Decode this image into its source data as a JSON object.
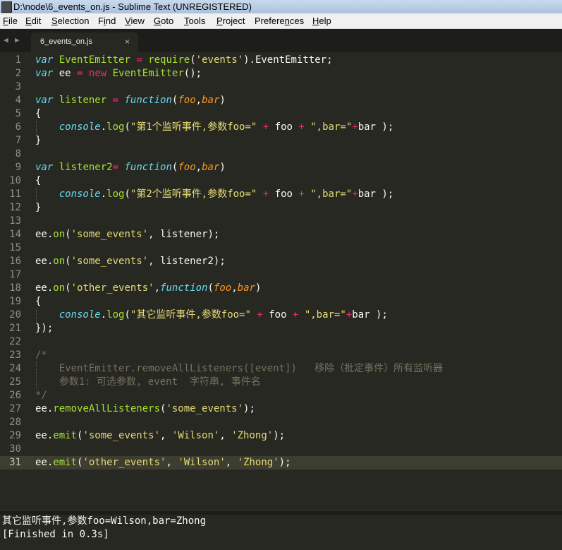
{
  "window": {
    "title": "D:\\node\\6_events_on.js - Sublime Text (UNREGISTERED)"
  },
  "menu": [
    {
      "name": "file",
      "pre": "",
      "u": "F",
      "post": "ile"
    },
    {
      "name": "edit",
      "pre": "",
      "u": "E",
      "post": "dit"
    },
    {
      "name": "selection",
      "pre": "",
      "u": "S",
      "post": "election"
    },
    {
      "name": "find",
      "pre": "F",
      "u": "i",
      "post": "nd"
    },
    {
      "name": "view",
      "pre": "",
      "u": "V",
      "post": "iew"
    },
    {
      "name": "goto",
      "pre": "",
      "u": "G",
      "post": "oto"
    },
    {
      "name": "tools",
      "pre": "",
      "u": "T",
      "post": "ools"
    },
    {
      "name": "project",
      "pre": "",
      "u": "P",
      "post": "roject"
    },
    {
      "name": "preferences",
      "pre": "Prefere",
      "u": "n",
      "post": "ces"
    },
    {
      "name": "help",
      "pre": "",
      "u": "H",
      "post": "elp"
    }
  ],
  "tab": {
    "label": "6_events_on.js",
    "close": "×",
    "nav_left": "◀",
    "nav_right": "▶"
  },
  "editor": {
    "current_line": 31,
    "lines": [
      {
        "n": "1",
        "t": [
          [
            "kw",
            "var"
          ],
          [
            "pl",
            " "
          ],
          [
            "fn",
            "EventEmitter"
          ],
          [
            "pl",
            " "
          ],
          [
            "op",
            "="
          ],
          [
            "pl",
            " "
          ],
          [
            "fn",
            "require"
          ],
          [
            "pl",
            "("
          ],
          [
            "str",
            "'events'"
          ],
          [
            "pl",
            ").EventEmitter;"
          ]
        ]
      },
      {
        "n": "2",
        "t": [
          [
            "kw",
            "var"
          ],
          [
            "pl",
            " ee "
          ],
          [
            "op",
            "="
          ],
          [
            "pl",
            " "
          ],
          [
            "op",
            "new"
          ],
          [
            "pl",
            " "
          ],
          [
            "fn",
            "EventEmitter"
          ],
          [
            "pl",
            "();"
          ]
        ]
      },
      {
        "n": "3",
        "t": []
      },
      {
        "n": "4",
        "t": [
          [
            "kw",
            "var"
          ],
          [
            "pl",
            " "
          ],
          [
            "fn",
            "listener"
          ],
          [
            "pl",
            " "
          ],
          [
            "op",
            "="
          ],
          [
            "pl",
            " "
          ],
          [
            "kw",
            "function"
          ],
          [
            "pl",
            "("
          ],
          [
            "param",
            "foo"
          ],
          [
            "pl",
            ","
          ],
          [
            "param",
            "bar"
          ],
          [
            "pl",
            ")"
          ]
        ]
      },
      {
        "n": "5",
        "t": [
          [
            "pl",
            "{"
          ]
        ]
      },
      {
        "n": "6",
        "g": true,
        "t": [
          [
            "pl",
            "    "
          ],
          [
            "kw",
            "console"
          ],
          [
            "pl",
            "."
          ],
          [
            "fn",
            "log"
          ],
          [
            "pl",
            "("
          ],
          [
            "str",
            "\"第1个监听事件,参数foo=\""
          ],
          [
            "pl",
            " "
          ],
          [
            "op",
            "+"
          ],
          [
            "pl",
            " foo "
          ],
          [
            "op",
            "+"
          ],
          [
            "pl",
            " "
          ],
          [
            "str",
            "\",bar=\""
          ],
          [
            "op",
            "+"
          ],
          [
            "pl",
            "bar );"
          ]
        ]
      },
      {
        "n": "7",
        "t": [
          [
            "pl",
            "}"
          ]
        ]
      },
      {
        "n": "8",
        "t": []
      },
      {
        "n": "9",
        "t": [
          [
            "kw",
            "var"
          ],
          [
            "pl",
            " "
          ],
          [
            "fn",
            "listener2"
          ],
          [
            "op",
            "="
          ],
          [
            "pl",
            " "
          ],
          [
            "kw",
            "function"
          ],
          [
            "pl",
            "("
          ],
          [
            "param",
            "foo"
          ],
          [
            "pl",
            ","
          ],
          [
            "param",
            "bar"
          ],
          [
            "pl",
            ")"
          ]
        ]
      },
      {
        "n": "10",
        "t": [
          [
            "pl",
            "{"
          ]
        ]
      },
      {
        "n": "11",
        "g": true,
        "t": [
          [
            "pl",
            "    "
          ],
          [
            "kw",
            "console"
          ],
          [
            "pl",
            "."
          ],
          [
            "fn",
            "log"
          ],
          [
            "pl",
            "("
          ],
          [
            "str",
            "\"第2个监听事件,参数foo=\""
          ],
          [
            "pl",
            " "
          ],
          [
            "op",
            "+"
          ],
          [
            "pl",
            " foo "
          ],
          [
            "op",
            "+"
          ],
          [
            "pl",
            " "
          ],
          [
            "str",
            "\",bar=\""
          ],
          [
            "op",
            "+"
          ],
          [
            "pl",
            "bar );"
          ]
        ]
      },
      {
        "n": "12",
        "t": [
          [
            "pl",
            "}"
          ]
        ]
      },
      {
        "n": "13",
        "t": []
      },
      {
        "n": "14",
        "t": [
          [
            "pl",
            "ee."
          ],
          [
            "fn",
            "on"
          ],
          [
            "pl",
            "("
          ],
          [
            "str",
            "'some_events'"
          ],
          [
            "pl",
            ", listener);"
          ]
        ]
      },
      {
        "n": "15",
        "t": []
      },
      {
        "n": "16",
        "t": [
          [
            "pl",
            "ee."
          ],
          [
            "fn",
            "on"
          ],
          [
            "pl",
            "("
          ],
          [
            "str",
            "'some_events'"
          ],
          [
            "pl",
            ", listener2);"
          ]
        ]
      },
      {
        "n": "17",
        "t": []
      },
      {
        "n": "18",
        "t": [
          [
            "pl",
            "ee."
          ],
          [
            "fn",
            "on"
          ],
          [
            "pl",
            "("
          ],
          [
            "str",
            "'other_events'"
          ],
          [
            "pl",
            ","
          ],
          [
            "kw",
            "function"
          ],
          [
            "pl",
            "("
          ],
          [
            "param",
            "foo"
          ],
          [
            "pl",
            ","
          ],
          [
            "param",
            "bar"
          ],
          [
            "pl",
            ")"
          ]
        ]
      },
      {
        "n": "19",
        "t": [
          [
            "pl",
            "{"
          ]
        ]
      },
      {
        "n": "20",
        "g": true,
        "t": [
          [
            "pl",
            "    "
          ],
          [
            "kw",
            "console"
          ],
          [
            "pl",
            "."
          ],
          [
            "fn",
            "log"
          ],
          [
            "pl",
            "("
          ],
          [
            "str",
            "\"其它监听事件,参数foo=\""
          ],
          [
            "pl",
            " "
          ],
          [
            "op",
            "+"
          ],
          [
            "pl",
            " foo "
          ],
          [
            "op",
            "+"
          ],
          [
            "pl",
            " "
          ],
          [
            "str",
            "\",bar=\""
          ],
          [
            "op",
            "+"
          ],
          [
            "pl",
            "bar );"
          ]
        ]
      },
      {
        "n": "21",
        "t": [
          [
            "pl",
            "});"
          ]
        ]
      },
      {
        "n": "22",
        "t": []
      },
      {
        "n": "23",
        "t": [
          [
            "cm",
            "/*"
          ]
        ]
      },
      {
        "n": "24",
        "g": true,
        "t": [
          [
            "cm",
            "    EventEmitter.removeAllListeners([event])   移除（批定事件）所有监听器"
          ]
        ]
      },
      {
        "n": "25",
        "g": true,
        "t": [
          [
            "cm",
            "    参数1: 可选参数, event  字符串, 事件名"
          ]
        ]
      },
      {
        "n": "26",
        "t": [
          [
            "cm",
            "*/"
          ]
        ]
      },
      {
        "n": "27",
        "t": [
          [
            "pl",
            "ee."
          ],
          [
            "fn",
            "removeAllListeners"
          ],
          [
            "pl",
            "("
          ],
          [
            "str",
            "'some_events'"
          ],
          [
            "pl",
            ");"
          ]
        ]
      },
      {
        "n": "28",
        "t": []
      },
      {
        "n": "29",
        "t": [
          [
            "pl",
            "ee."
          ],
          [
            "fn",
            "emit"
          ],
          [
            "pl",
            "("
          ],
          [
            "str",
            "'some_events'"
          ],
          [
            "pl",
            ", "
          ],
          [
            "str",
            "'Wilson'"
          ],
          [
            "pl",
            ", "
          ],
          [
            "str",
            "'Zhong'"
          ],
          [
            "pl",
            ");"
          ]
        ]
      },
      {
        "n": "30",
        "t": []
      },
      {
        "n": "31",
        "t": [
          [
            "pl",
            "ee."
          ],
          [
            "fn",
            "emit"
          ],
          [
            "pl",
            "("
          ],
          [
            "str",
            "'other_events'"
          ],
          [
            "pl",
            ", "
          ],
          [
            "str",
            "'Wilson'"
          ],
          [
            "pl",
            ", "
          ],
          [
            "str",
            "'Zhong'"
          ],
          [
            "pl",
            ");"
          ]
        ]
      }
    ]
  },
  "output": {
    "lines": [
      "其它监听事件,参数foo=Wilson,bar=Zhong",
      "[Finished in 0.3s]"
    ]
  },
  "colors": {
    "background": "#272822",
    "keyword": "#66d9ef",
    "function": "#a6e22e",
    "operator": "#f92672",
    "string": "#e6db74",
    "parameter": "#fd971f",
    "comment": "#75715e",
    "text": "#f8f8f2"
  }
}
